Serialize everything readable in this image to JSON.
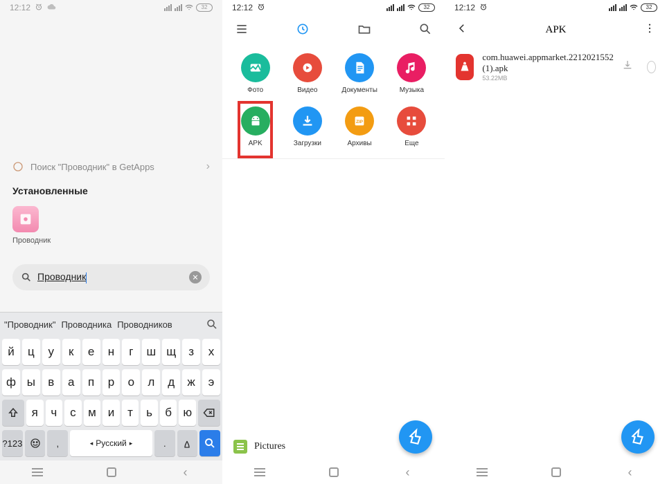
{
  "status": {
    "time": "12:12",
    "battery_label": "32"
  },
  "screen1": {
    "search_app_label": "Поиск \"Проводник\" в GetApps",
    "installed_heading": "Установленные",
    "app_label": "Проводник",
    "search_value": "Проводник",
    "suggestions": [
      "\"Проводник\"",
      "Проводника",
      "Проводников"
    ],
    "kb_row1": [
      "й",
      "ц",
      "у",
      "к",
      "е",
      "н",
      "г",
      "ш",
      "щ",
      "з",
      "х"
    ],
    "kb_row2": [
      "ф",
      "ы",
      "в",
      "а",
      "п",
      "р",
      "о",
      "л",
      "д",
      "ж",
      "э"
    ],
    "kb_row3": [
      "я",
      "ч",
      "с",
      "м",
      "и",
      "т",
      "ь",
      "б",
      "ю"
    ],
    "numkey": "?123",
    "lang": "Русский"
  },
  "screen2": {
    "cells": [
      {
        "label": "Фото",
        "color": "#1abc9c"
      },
      {
        "label": "Видео",
        "color": "#e74c3c"
      },
      {
        "label": "Документы",
        "color": "#2196f3"
      },
      {
        "label": "Музыка",
        "color": "#e91e63"
      },
      {
        "label": "APK",
        "color": "#27ae60",
        "highlight": true
      },
      {
        "label": "Загрузки",
        "color": "#2196f3"
      },
      {
        "label": "Архивы",
        "color": "#f39c12"
      },
      {
        "label": "Еще",
        "color": "#e74c3c"
      }
    ],
    "pictures_label": "Pictures"
  },
  "screen3": {
    "title": "APK",
    "item_name": "com.huawei.appmarket.2212021552 (1).apk",
    "item_size": "53.22MB"
  }
}
